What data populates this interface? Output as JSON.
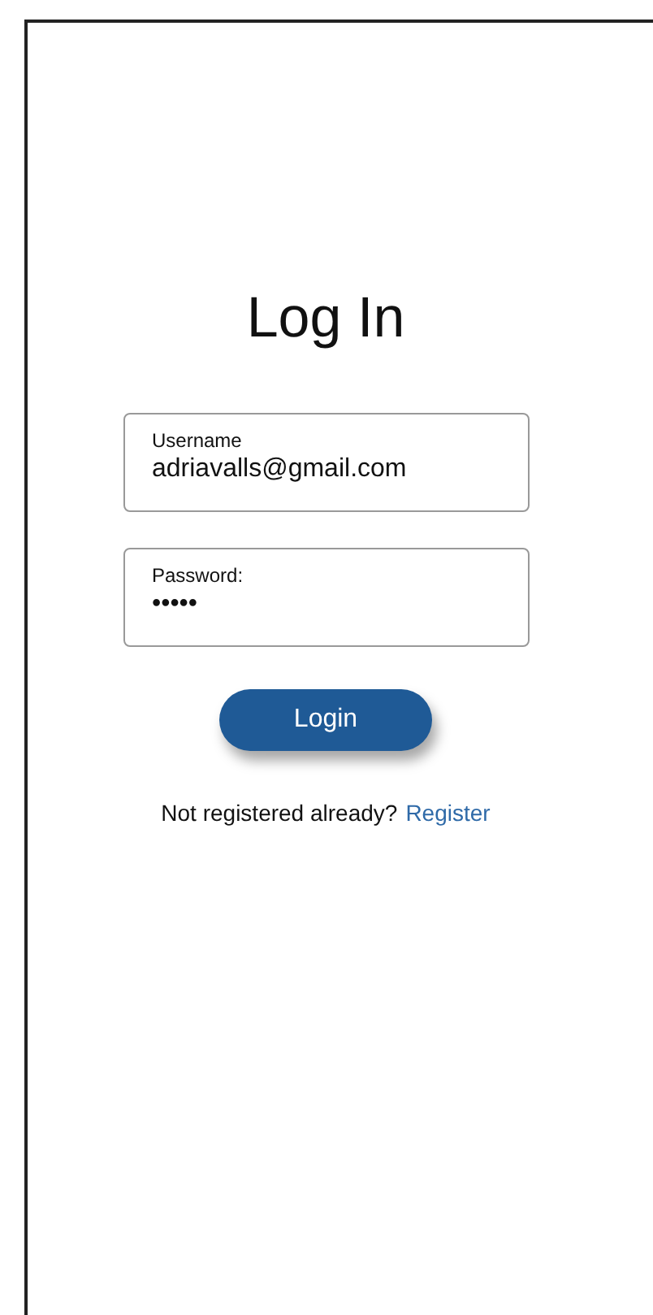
{
  "title": "Log In",
  "fields": [
    {
      "label": "Username",
      "value": "adriavalls@gmail.com"
    },
    {
      "label": "Password:",
      "value": "•••••"
    }
  ],
  "button": "Login",
  "footer": {
    "text": "Not registered already?",
    "link": "Register"
  }
}
